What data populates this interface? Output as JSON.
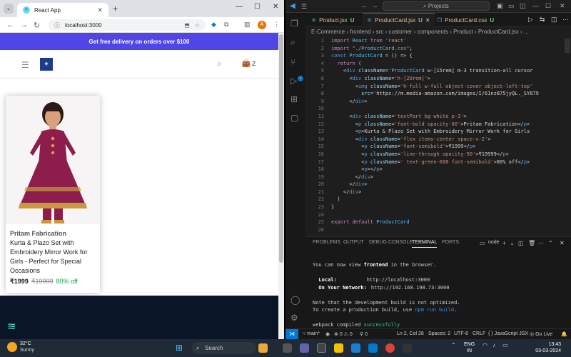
{
  "browser": {
    "tab_title": "React App",
    "url": "localhost:3000",
    "tab_dropdown_icon": "chevron-down-icon",
    "new_tab_glyph": "+"
  },
  "site": {
    "promo": "Get free delivery on orders over $100",
    "cart_count": "2",
    "product": {
      "brand": "Pritam Fabrication",
      "title": "Kurta & Plazo Set with Embroidery Mirror Work for Girls - Perfect for Special Occasions",
      "price": "₹1999",
      "original_price": "₹19999",
      "discount": "80% off"
    },
    "colors": {
      "promo_bg": "#4f46e5",
      "discount": "#16a34a"
    }
  },
  "vscode": {
    "search_label": "Projects",
    "tabs": [
      {
        "name": "Product.jsx",
        "status": "U",
        "icon": "react-icon"
      },
      {
        "name": "ProductCard.jsx",
        "status": "U",
        "icon": "react-icon"
      },
      {
        "name": "ProductCard.css",
        "status": "U",
        "icon": "css-icon"
      }
    ],
    "breadcrumb": "E-Commerce › frontend › src › customer › components › Product › ProductCard.jsx › ...",
    "line_numbers": [
      "1",
      "2",
      "3",
      "4",
      "5",
      "6",
      "7",
      "8",
      "9",
      "10",
      "11",
      "12",
      "13",
      "14",
      "15",
      "16",
      "17",
      "18",
      "19",
      "20",
      "21",
      "22",
      "23",
      "24",
      "25",
      "26"
    ],
    "code": [
      "import React from 'react'",
      "import \"./ProductCard.css\";",
      "const ProductCard = () => {",
      "  return (",
      "    <div className='ProductCard w-[15rem] m-3 transition-all cursor",
      "      <div className='h-[20rem]'>",
      "        <img className='h-full w-full object-cover object-left-top'",
      "          src='https://m.media-amazon.com/images/I/61nz875jyQL._SY879",
      "      </div>",
      "",
      "      <div className='textPart bg-white p-3'>",
      "        <p className='font-bold opacity-60'>Pritam Fabrication</p>",
      "        <p>Kurta & Plazo Set with Embroidery Mirror Work for Girls",
      "        <div className='flex items-center space-x-2'>",
      "          <p className='font-semibold'>₹1999</p>",
      "          <p className='line-through opacity-50'>₹19999</p>",
      "          <p className=' text-green-600 font-semibold'>80% off</p>",
      "          <p></p>",
      "        </div>",
      "      </div>",
      "    </div>",
      "  )",
      "}",
      "",
      "export default ProductCard",
      ""
    ],
    "panel_tabs": [
      "PROBLEMS",
      "OUTPUT",
      "DEBUG CONSOLE",
      "TERMINAL",
      "PORTS"
    ],
    "terminal_shell": "node",
    "terminal": {
      "view_prefix": "You can now view ",
      "app_name": "frontend",
      "view_suffix": " in the browser.",
      "local_label": "  Local:",
      "local_url": "http://localhost:3000",
      "network_label": "  On Your Network:",
      "network_url": "http://192.168.198.73:3000",
      "note1": "Note that the development build is not optimized.",
      "note2_prefix": "To create a production build, use ",
      "note2_cmd": "npm run build",
      "note2_suffix": ".",
      "compiled_prefix": "webpack compiled ",
      "compiled_status": "successfully"
    },
    "status": {
      "branch": "main*",
      "errors": "0",
      "warnings": "0",
      "ports": "0",
      "position": "Ln 2, Col 28",
      "spaces": "Spaces: 2",
      "encoding": "UTF-8",
      "eol": "CRLF",
      "language": "JavaScript JSX",
      "golive": "Go Live"
    }
  },
  "taskbar": {
    "temp": "32°C",
    "weather": "Sunny",
    "search": "Search",
    "lang_line1": "ENG",
    "lang_line2": "IN",
    "time": "13:43",
    "date": "03-03-2024"
  }
}
